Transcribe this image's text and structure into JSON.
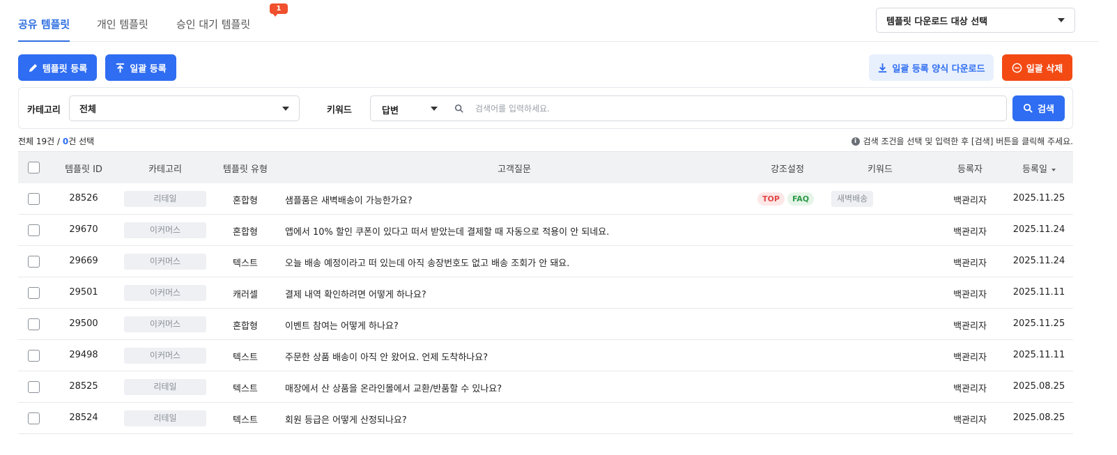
{
  "tabs": [
    {
      "label": "공유 템플릿",
      "active": true
    },
    {
      "label": "개인 템플릿",
      "active": false
    },
    {
      "label": "승인 대기 템플릿",
      "active": false,
      "badge": "1"
    }
  ],
  "download_target_select": {
    "value": "템플릿 다운로드 대상 선택"
  },
  "toolbar": {
    "register_label": "템플릿 등록",
    "bulk_register_label": "일괄 등록",
    "form_download_label": "일괄 등록 양식 다운로드",
    "bulk_delete_label": "일괄 삭제"
  },
  "filter": {
    "category_label": "카테고리",
    "category_value": "전체",
    "keyword_label": "키워드",
    "keyword_type": "답변",
    "search_placeholder": "검색어를 입력하세요.",
    "search_button": "검색"
  },
  "summary": {
    "prefix": "전체 19건 / ",
    "selected": "0",
    "suffix": "건 선택"
  },
  "hint": "검색 조건을 선택 및 입력한 후 [검색] 버튼을 클릭해 주세요.",
  "table": {
    "headers": {
      "id": "템플릿 ID",
      "category": "카테고리",
      "type": "템플릿 유형",
      "question": "고객질문",
      "emphasis": "강조설정",
      "keyword": "키워드",
      "author": "등록자",
      "date": "등록일"
    },
    "rows": [
      {
        "id": "28526",
        "category": "리테일",
        "type": "혼합형",
        "question": "샘플품은 새벽배송이 가능한가요?",
        "emphasis": [
          "TOP",
          "FAQ"
        ],
        "keyword": "새벽배송",
        "author": "백관리자",
        "date": "2025.11.25"
      },
      {
        "id": "29670",
        "category": "이커머스",
        "type": "혼합형",
        "question": "앱에서 10% 할인 쿠폰이 있다고 떠서 받았는데 결제할 때 자동으로 적용이 안 되네요.",
        "emphasis": [],
        "keyword": "",
        "author": "백관리자",
        "date": "2025.11.24"
      },
      {
        "id": "29669",
        "category": "이커머스",
        "type": "텍스트",
        "question": "오늘 배송 예정이라고 떠 있는데 아직 송장번호도 없고 배송 조회가 안 돼요.",
        "emphasis": [],
        "keyword": "",
        "author": "백관리자",
        "date": "2025.11.24"
      },
      {
        "id": "29501",
        "category": "이커머스",
        "type": "캐러셀",
        "question": "결제 내역 확인하려면 어떻게 하나요?",
        "emphasis": [],
        "keyword": "",
        "author": "백관리자",
        "date": "2025.11.11"
      },
      {
        "id": "29500",
        "category": "이커머스",
        "type": "혼합형",
        "question": "이벤트 참여는 어떻게 하나요?",
        "emphasis": [],
        "keyword": "",
        "author": "백관리자",
        "date": "2025.11.25"
      },
      {
        "id": "29498",
        "category": "이커머스",
        "type": "텍스트",
        "question": "주문한 상품 배송이 아직 안 왔어요. 언제 도착하나요?",
        "emphasis": [],
        "keyword": "",
        "author": "백관리자",
        "date": "2025.11.11"
      },
      {
        "id": "28525",
        "category": "리테일",
        "type": "텍스트",
        "question": "매장에서 산 상품을 온라인몰에서 교환/반품할 수 있나요?",
        "emphasis": [],
        "keyword": "",
        "author": "백관리자",
        "date": "2025.08.25"
      },
      {
        "id": "28524",
        "category": "리테일",
        "type": "텍스트",
        "question": "회원 등급은 어떻게 산정되나요?",
        "emphasis": [],
        "keyword": "",
        "author": "백관리자",
        "date": "2025.08.25"
      }
    ]
  },
  "colors": {
    "primary": "#2f6df2",
    "danger": "#f34a14",
    "badge": "#f0502d",
    "light_primary": "#e8f0fd"
  }
}
